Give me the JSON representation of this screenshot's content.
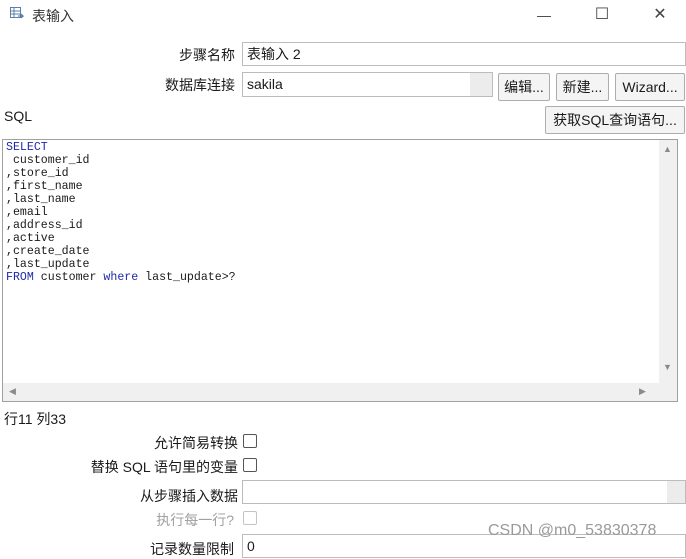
{
  "window": {
    "title": "表输入",
    "minimize_glyph": "—",
    "maximize_glyph": "☐",
    "close_glyph": "✕",
    "app_icon": "table-input-icon"
  },
  "form": {
    "step_name_label": "步骤名称",
    "step_name_value": "表输入 2",
    "db_connection_label": "数据库连接",
    "db_connection_value": "sakila",
    "edit_button": "编辑...",
    "new_button": "新建...",
    "wizard_button": "Wizard...",
    "sql_label": "SQL",
    "get_sql_button": "获取SQL查询语句..."
  },
  "sql_editor": {
    "lines": [
      {
        "kw": "SELECT",
        "text": ""
      },
      {
        "kw": "",
        "text": " customer_id"
      },
      {
        "kw": "",
        "text": ",store_id"
      },
      {
        "kw": "",
        "text": ",first_name"
      },
      {
        "kw": "",
        "text": ",last_name"
      },
      {
        "kw": "",
        "text": ",email"
      },
      {
        "kw": "",
        "text": ",address_id"
      },
      {
        "kw": "",
        "text": ",active"
      },
      {
        "kw": "",
        "text": ",create_date"
      },
      {
        "kw": "",
        "text": ",last_update"
      }
    ],
    "last_line": {
      "kw1": "FROM",
      "text1": " customer ",
      "kw2": "where",
      "text2": " last_update>?"
    }
  },
  "status": {
    "cursor_position": "行11 列33"
  },
  "options": {
    "lazy_conversion_label": "允许简易转换",
    "replace_variables_label": "替换 SQL 语句里的变量",
    "insert_from_step_label": "从步骤插入数据",
    "insert_from_step_value": "",
    "execute_each_row_label": "执行每一行?",
    "limit_label": "记录数量限制",
    "limit_value": "0"
  },
  "watermark": "CSDN @m0_53830378"
}
